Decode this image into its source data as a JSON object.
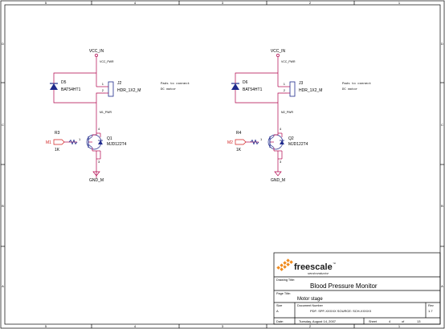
{
  "border": {
    "top_cols": [
      "5",
      "4",
      "3",
      "2",
      "1"
    ],
    "bottom_cols": [
      "5",
      "4",
      "3",
      "2",
      "1"
    ],
    "left_rows": [
      "D",
      "C",
      "B",
      "A"
    ],
    "right_rows": [
      "D",
      "C",
      "B",
      "A"
    ]
  },
  "circuits": [
    {
      "vcc_in": "VCC_IN",
      "vcc_pwr": "VCC_PWR",
      "diode_ref": "D5",
      "diode_part": "BAT54HT1",
      "header_ref": "J2",
      "header_part": "HDR_1X2_M",
      "note_line1": "Pads to connect",
      "note_line2": "DC motor",
      "pwr_net": "M1_PWR",
      "resistor_ref": "R3",
      "resistor_val": "1K",
      "input_port": "M1",
      "transistor_ref": "Q1",
      "transistor_part": "MJD122T4",
      "gnd": "GND_M",
      "pins": {
        "p1": "1",
        "p2": "2",
        "p3": "3",
        "p4": "4",
        "j1": "1",
        "j2": "2"
      }
    },
    {
      "vcc_in": "VCC_IN",
      "vcc_pwr": "VCC_PWR",
      "diode_ref": "D6",
      "diode_part": "BAT54HT1",
      "header_ref": "J3",
      "header_part": "HDR_1X2_M",
      "note_line1": "Pads to connect",
      "note_line2": "DC motor",
      "pwr_net": "M2_PWR",
      "resistor_ref": "R4",
      "resistor_val": "1K",
      "input_port": "M2",
      "transistor_ref": "Q2",
      "transistor_part": "MJD122T4",
      "gnd": "GND_M",
      "pins": {
        "p1": "1",
        "p2": "2",
        "p3": "3",
        "p4": "4",
        "j1": "1",
        "j2": "2"
      }
    }
  ],
  "title_block": {
    "logo_text": "freescale",
    "logo_tm": "™",
    "logo_sub": "semiconductor",
    "drawing_title_label": "Drawing Title:",
    "drawing_title": "Blood Pressure Monitor",
    "page_title_label": "Page Title:",
    "page_title": "Motor stage",
    "size_label": "Size",
    "size_value": "A",
    "docnum_label": "Document Number",
    "docnum_value": "PDF: SPF-XXXXX  SOURCE: SCH-XXXXX",
    "rev_label": "Rev",
    "rev_value": "1.7",
    "date_label": "Date:",
    "date_value": "Tuesday, August 14, 2007",
    "sheet_label": "Sheet",
    "sheet_num": "4",
    "sheet_of": "of",
    "sheet_total": "13"
  },
  "colors": {
    "wire": "#b0004a",
    "component": "#1f2a8c",
    "port": "#d11e1e",
    "logo_orange": "#f08a1c"
  }
}
